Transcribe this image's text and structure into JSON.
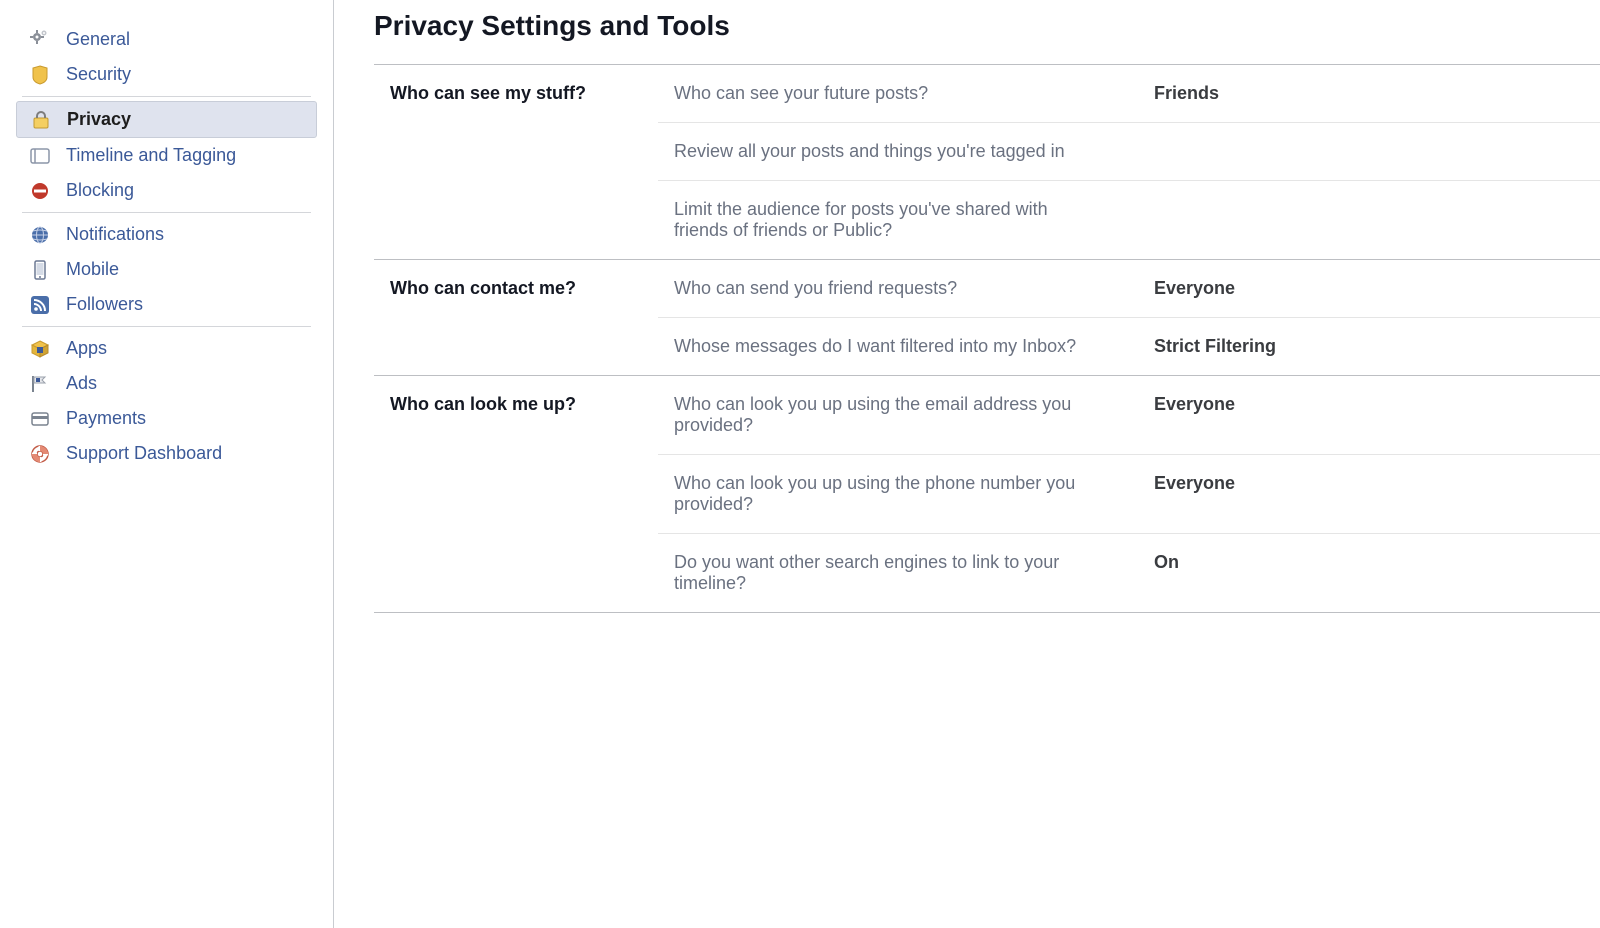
{
  "page": {
    "title": "Privacy Settings and Tools"
  },
  "sidebar": {
    "groups": [
      {
        "items": [
          {
            "key": "general",
            "label": "General",
            "icon": "gear"
          },
          {
            "key": "security",
            "label": "Security",
            "icon": "badge"
          }
        ]
      },
      {
        "items": [
          {
            "key": "privacy",
            "label": "Privacy",
            "icon": "lock",
            "active": true
          },
          {
            "key": "timeline",
            "label": "Timeline and Tagging",
            "icon": "timeline"
          },
          {
            "key": "blocking",
            "label": "Blocking",
            "icon": "block"
          }
        ]
      },
      {
        "items": [
          {
            "key": "notifications",
            "label": "Notifications",
            "icon": "globe"
          },
          {
            "key": "mobile",
            "label": "Mobile",
            "icon": "mobile"
          },
          {
            "key": "followers",
            "label": "Followers",
            "icon": "rss"
          }
        ]
      },
      {
        "items": [
          {
            "key": "apps",
            "label": "Apps",
            "icon": "box"
          },
          {
            "key": "ads",
            "label": "Ads",
            "icon": "flag"
          },
          {
            "key": "payments",
            "label": "Payments",
            "icon": "card"
          },
          {
            "key": "support",
            "label": "Support Dashboard",
            "icon": "lifebuoy"
          }
        ]
      }
    ]
  },
  "sections": [
    {
      "title": "Who can see my stuff?",
      "rows": [
        {
          "label": "Who can see your future posts?",
          "value": "Friends"
        },
        {
          "label": "Review all your posts and things you're tagged in",
          "value": ""
        },
        {
          "label": "Limit the audience for posts you've shared with friends of friends or Public?",
          "value": ""
        }
      ]
    },
    {
      "title": "Who can contact me?",
      "rows": [
        {
          "label": "Who can send you friend requests?",
          "value": "Everyone"
        },
        {
          "label": "Whose messages do I want filtered into my Inbox?",
          "value": "Strict Filtering"
        }
      ]
    },
    {
      "title": "Who can look me up?",
      "rows": [
        {
          "label": "Who can look you up using the email address you provided?",
          "value": "Everyone"
        },
        {
          "label": "Who can look you up using the phone number you provided?",
          "value": "Everyone"
        },
        {
          "label": "Do you want other search engines to link to your timeline?",
          "value": "On"
        }
      ]
    }
  ]
}
